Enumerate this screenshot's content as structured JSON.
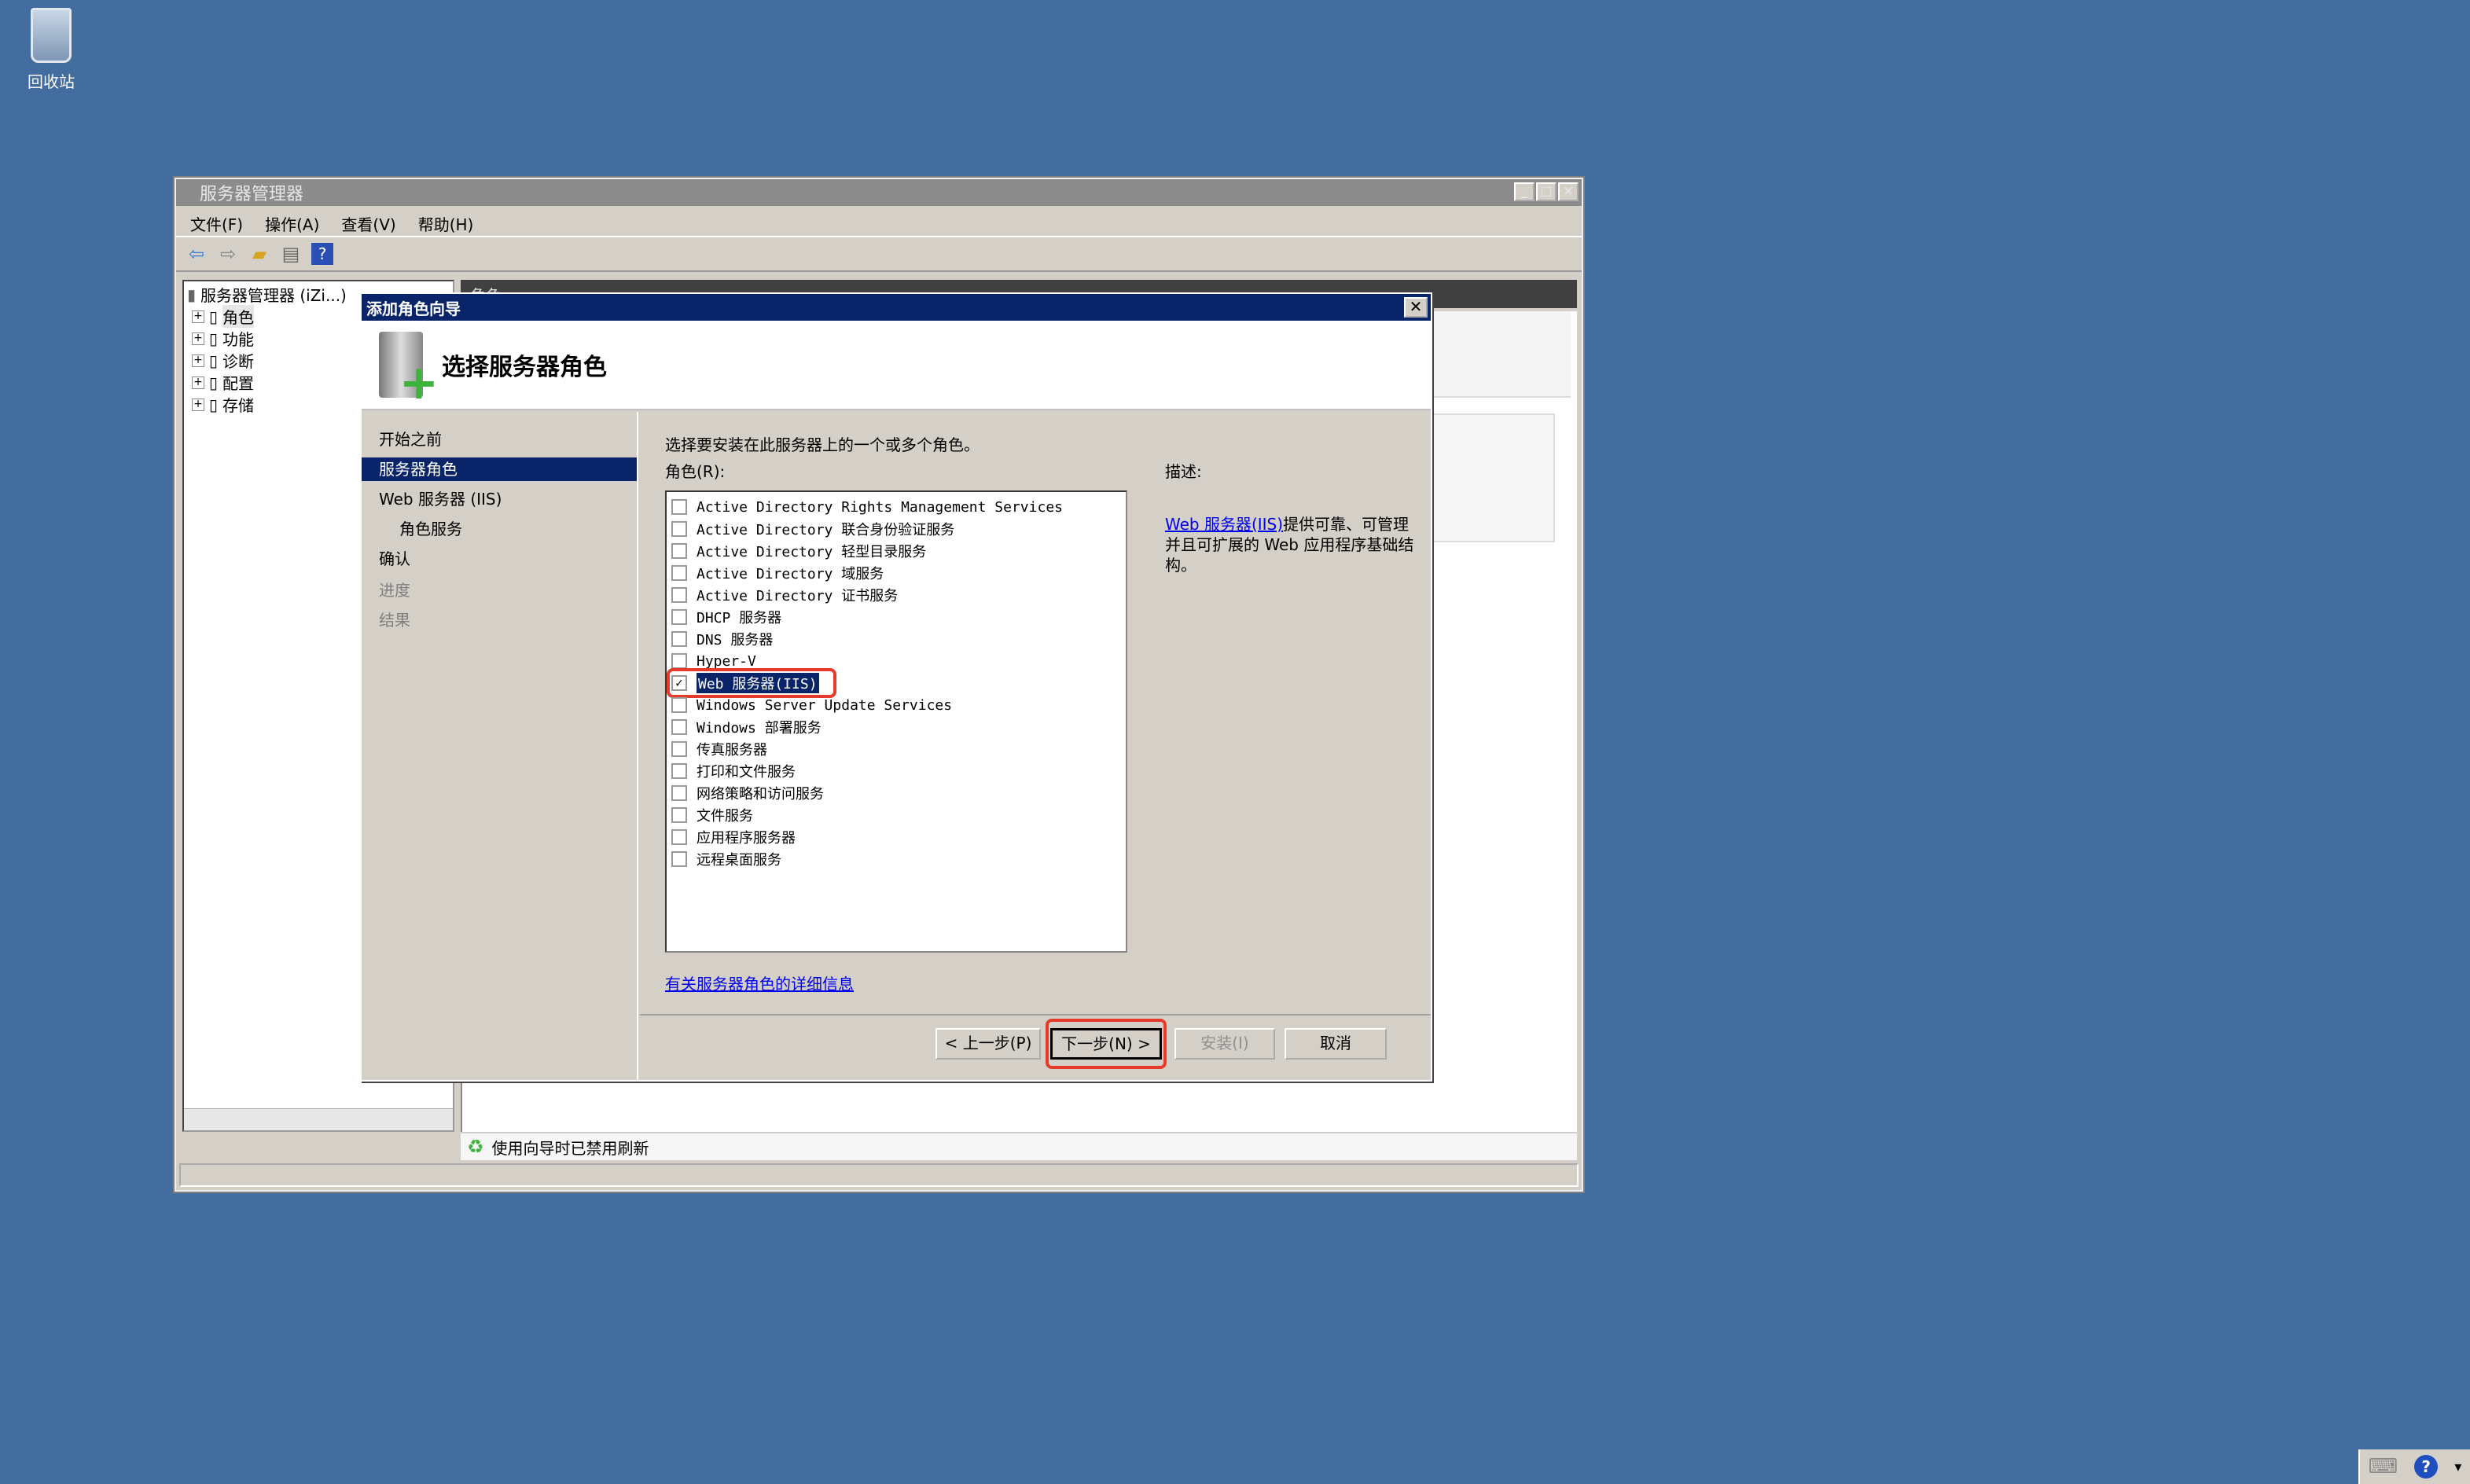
{
  "desktop": {
    "recycle_bin": "回收站"
  },
  "main_window": {
    "title": "服务器管理器",
    "menu": [
      "文件(F)",
      "操作(A)",
      "查看(V)",
      "帮助(H)"
    ],
    "tree": {
      "root": "服务器管理器 (iZi...)",
      "items": [
        "角色",
        "功能",
        "诊断",
        "配置",
        "存储"
      ]
    },
    "right_header": "角色",
    "status_text": "使用向导时已禁用刷新"
  },
  "wizard": {
    "title": "添加角色向导",
    "heading": "选择服务器角色",
    "nav": [
      {
        "label": "开始之前",
        "state": "normal"
      },
      {
        "label": "服务器角色",
        "state": "selected"
      },
      {
        "label": "Web 服务器 (IIS)",
        "state": "normal"
      },
      {
        "label": "角色服务",
        "state": "normal"
      },
      {
        "label": "确认",
        "state": "normal"
      },
      {
        "label": "进度",
        "state": "disabled"
      },
      {
        "label": "结果",
        "state": "disabled"
      }
    ],
    "instruction": "选择要安装在此服务器上的一个或多个角色。",
    "roles_label": "角色(R):",
    "roles": [
      {
        "label": "Active Directory Rights Management Services",
        "checked": false
      },
      {
        "label": "Active Directory 联合身份验证服务",
        "checked": false
      },
      {
        "label": "Active Directory 轻型目录服务",
        "checked": false
      },
      {
        "label": "Active Directory 域服务",
        "checked": false
      },
      {
        "label": "Active Directory 证书服务",
        "checked": false
      },
      {
        "label": "DHCP 服务器",
        "checked": false
      },
      {
        "label": "DNS 服务器",
        "checked": false
      },
      {
        "label": "Hyper-V",
        "checked": false
      },
      {
        "label": "Web 服务器(IIS)",
        "checked": true
      },
      {
        "label": "Windows Server Update Services",
        "checked": false
      },
      {
        "label": "Windows 部署服务",
        "checked": false
      },
      {
        "label": "传真服务器",
        "checked": false
      },
      {
        "label": "打印和文件服务",
        "checked": false
      },
      {
        "label": "网络策略和访问服务",
        "checked": false
      },
      {
        "label": "文件服务",
        "checked": false
      },
      {
        "label": "应用程序服务器",
        "checked": false
      },
      {
        "label": "远程桌面服务",
        "checked": false
      }
    ],
    "description_label": "描述:",
    "description_link": "Web 服务器(IIS)",
    "description_text": "提供可靠、可管理并且可扩展的 Web 应用程序基础结构。",
    "more_info_link": "有关服务器角色的详细信息",
    "buttons": {
      "back": "< 上一步(P)",
      "next": "下一步(N) >",
      "install": "安装(I)",
      "cancel": "取消"
    }
  },
  "colors": {
    "desktop": "#436c9f",
    "selection": "#0a246a",
    "highlight": "#e53a2c",
    "link": "#0000ee"
  }
}
